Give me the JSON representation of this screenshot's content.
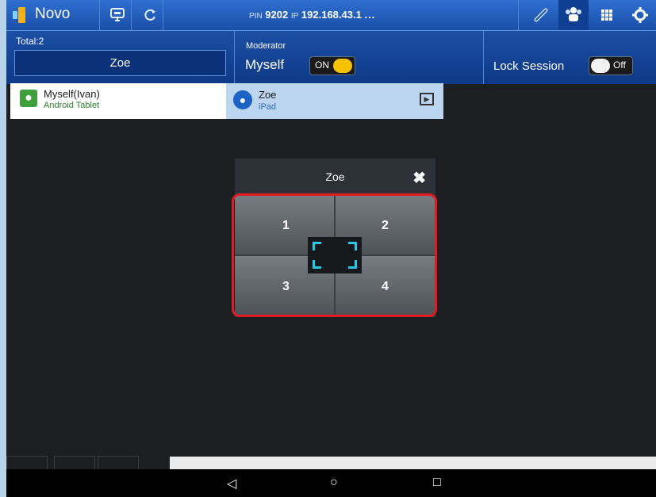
{
  "app": {
    "title": "Novo"
  },
  "topbar": {
    "pin_label": "PIN",
    "pin_value": "9202",
    "ip_label": "IP",
    "ip_value": "192.168.43.1",
    "more": "..."
  },
  "session": {
    "total_label": "Total:2",
    "current_presenter": "Zoe",
    "moderator_label": "Moderator",
    "moderator_value": "Myself",
    "moderator_toggle": "ON",
    "lock_label": "Lock Session",
    "lock_toggle": "Off"
  },
  "participants": [
    {
      "name": "Myself(Ivan)",
      "device": "Android Tablet"
    },
    {
      "name": "Zoe",
      "device": "iPad"
    }
  ],
  "dialog": {
    "title": "Zoe",
    "quadrants": [
      "1",
      "2",
      "3",
      "4"
    ]
  },
  "navbar": {
    "back": "◁",
    "home": "○",
    "recents": "□"
  },
  "colors": {
    "accent_blue": "#1a4fa8",
    "highlight": "#e11b22",
    "toggle_on": "#f5c200",
    "fullscreen_corners": "#29c8e8"
  }
}
